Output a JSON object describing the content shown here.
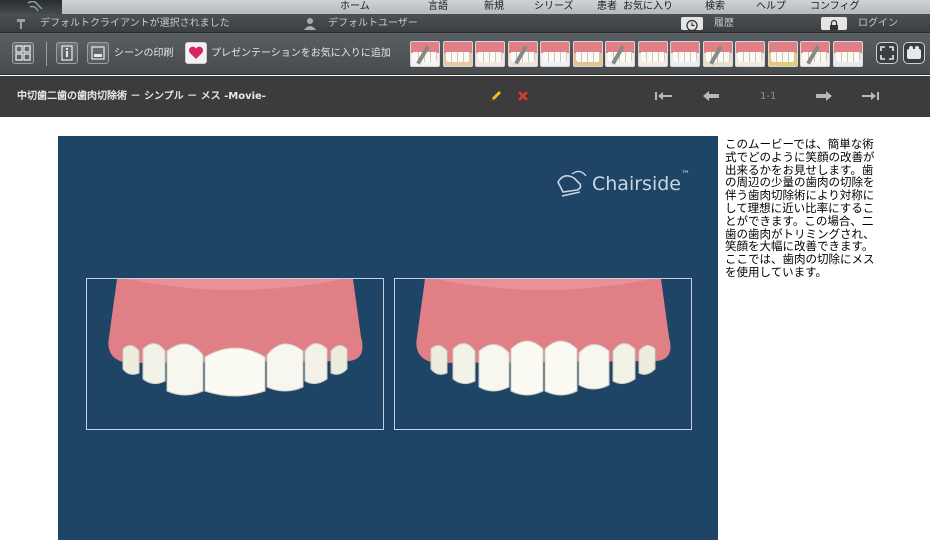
{
  "nav": {
    "items": [
      "ホーム",
      "言語",
      "新規",
      "シリーズ",
      "患者",
      "お気に入り",
      "検索",
      "ヘルプ",
      "コンフィグ"
    ]
  },
  "status": {
    "client": "デフォルトクライアントが選択されました",
    "user": "デフォルトユーザー",
    "history": "履歴",
    "login": "ログイン"
  },
  "toolbar": {
    "print_label": "シーンの印刷",
    "favorite_label": "プレゼンテーションをお気に入りに追加",
    "thumbnail_count": 14
  },
  "titlebar": {
    "title": "中切歯二歯の歯肉切除術 － シンプル － メス -Movie-",
    "page_indicator": "1-1"
  },
  "video": {
    "brand": "Chairside",
    "trademark": "™"
  },
  "description": "このムービーでは、簡単な術式でどのように笑顔の改善が出来るかをお見せします。歯の周辺の少量の歯肉の切除を伴う歯肉切除術により対称にして理想に近い比率にすることができます。この場合、二歯の歯肉がトリミングされ、笑顔を大幅に改善できます。ここでは、歯肉の切除にメスを使用しています。",
  "colors": {
    "video_bg": "#1e4565",
    "gum": "#e07f86",
    "titlebar": "#3c3c3c"
  }
}
